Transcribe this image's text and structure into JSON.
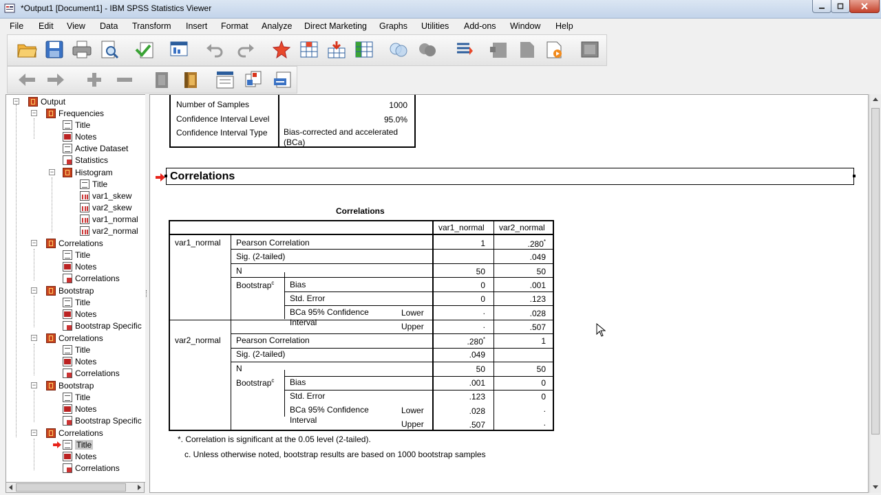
{
  "window": {
    "title": "*Output1 [Document1] - IBM SPSS Statistics Viewer"
  },
  "menu": [
    "File",
    "Edit",
    "View",
    "Data",
    "Transform",
    "Insert",
    "Format",
    "Analyze",
    "Direct Marketing",
    "Graphs",
    "Utilities",
    "Add-ons",
    "Window",
    "Help"
  ],
  "toolbar_icons": [
    "open-icon",
    "save-icon",
    "print-icon",
    "print-preview-icon",
    "export-icon",
    "recall-dialog-icon",
    "undo-icon",
    "redo-icon",
    "goto-case-icon",
    "goto-variable-icon",
    "insert-cases-icon",
    "variables-icon",
    "value-labels-icon",
    "use-sets-icon",
    "designate-window-icon",
    "create-title-icon",
    "insert-heading-icon",
    "insert-text-icon",
    "run-script-icon",
    "collapse-icon",
    "promote-icon",
    "demote-icon",
    "expand-icon",
    "show-icon",
    "hide-icon",
    "insert-output-icon",
    "copy-object-icon",
    "paste-icon"
  ],
  "tree": {
    "root": "Output",
    "nodes": [
      "Frequencies",
      "Title",
      "Notes",
      "Active Dataset",
      "Statistics",
      "Histogram",
      "Title",
      "var1_skew",
      "var2_skew",
      "var1_normal",
      "var2_normal",
      "Correlations",
      "Title",
      "Notes",
      "Correlations",
      "Bootstrap",
      "Title",
      "Notes",
      "Bootstrap Specific",
      "Correlations",
      "Title",
      "Notes",
      "Correlations",
      "Bootstrap",
      "Title",
      "Notes",
      "Bootstrap Specific",
      "Correlations",
      "Title",
      "Notes",
      "Correlations"
    ]
  },
  "bootstrap_spec": {
    "rows": [
      {
        "label": "Number of Samples",
        "value": "1000"
      },
      {
        "label": "Confidence Interval Level",
        "value": "95.0%"
      },
      {
        "label": "Confidence Interval Type",
        "value": "Bias-corrected and accelerated (BCa)"
      }
    ]
  },
  "heading": "Correlations",
  "corr_table": {
    "title": "Correlations",
    "col_headers": [
      "var1_normal",
      "var2_normal"
    ],
    "rows": {
      "v1": "var1_normal",
      "v2": "var2_normal",
      "pearson": "Pearson Correlation",
      "sig": "Sig. (2-tailed)",
      "n": "N",
      "bootstrap": "Bootstrap",
      "bootstrap_sup": "c",
      "bias": "Bias",
      "std_error": "Std. Error",
      "bca": "BCa 95% Confidence Interval",
      "lower": "Lower",
      "upper": "Upper"
    },
    "values": {
      "v1_pearson": [
        "1",
        ".280"
      ],
      "v1_sig": [
        "",
        ".049"
      ],
      "v1_n": [
        "50",
        "50"
      ],
      "v1_bias": [
        "0",
        ".001"
      ],
      "v1_se": [
        "0",
        ".123"
      ],
      "v1_lower": [
        ".",
        ".028"
      ],
      "v1_upper": [
        ".",
        ".507"
      ],
      "v2_pearson": [
        ".280",
        "1"
      ],
      "v2_sig": [
        ".049",
        ""
      ],
      "v2_n": [
        "50",
        "50"
      ],
      "v2_bias": [
        ".001",
        "0"
      ],
      "v2_se": [
        ".123",
        "0"
      ],
      "v2_lower": [
        ".028",
        "."
      ],
      "v2_upper": [
        ".507",
        "."
      ]
    },
    "star": "*",
    "footnotes": [
      "*. Correlation is significant at the 0.05 level (2-tailed).",
      "c. Unless otherwise noted, bootstrap results are based on 1000 bootstrap samples"
    ]
  }
}
